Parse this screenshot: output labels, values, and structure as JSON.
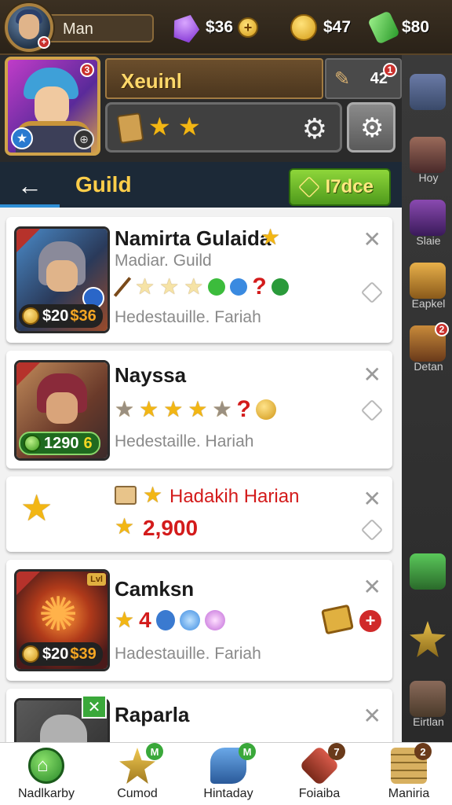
{
  "topbar": {
    "player_name": "Man",
    "avatar_badge": "+",
    "currencies": [
      {
        "icon": "purple-gem-icon",
        "value": "$36",
        "color": "#8a3cd6"
      },
      {
        "icon": "gold-coin-icon",
        "value": "$47",
        "color": "#e0a020"
      },
      {
        "icon": "green-energy-icon",
        "value": "$80",
        "color": "#3cc24a"
      }
    ]
  },
  "hero": {
    "name": "Xeuinl",
    "power": "42",
    "power_badge": "1",
    "portrait_badge": "3",
    "stars": 2,
    "colors": {
      "accent": "#d1a34a",
      "name_text": "#ffd86a"
    }
  },
  "guild_bar": {
    "title": "Guild",
    "back_glyph": "←",
    "trade_label": "I7dce"
  },
  "cards": [
    {
      "name": "Namirta Gulaida",
      "subtitle": "Madiar. Guild",
      "footer": "Hedestauille. Fariah",
      "price": "$20",
      "price_b": "$36",
      "question": "?",
      "close": "✕",
      "has_star_after_name": true
    },
    {
      "name": "Nayssa",
      "subtitle": "",
      "footer": "Hedestaille. Hariah",
      "price": "1290",
      "price_b": "6",
      "question": "?",
      "close": "✕",
      "has_star_after_name": false
    },
    {
      "name": "Hadakih Harian",
      "subtitle": "",
      "footer": "",
      "amount": "2,900",
      "close": "✕",
      "has_star_after_name": false
    },
    {
      "name": "Camksn",
      "subtitle": "",
      "footer": "Hadestauille. Fariah",
      "price": "$20",
      "price_b": "$39",
      "number": "4",
      "corner_tag": "Lvl",
      "close": "✕",
      "has_star_after_name": false
    },
    {
      "name": "Raparla",
      "subtitle": "",
      "footer": "",
      "close": "✕",
      "has_star_after_name": false
    }
  ],
  "right_strip": [
    {
      "label": "Hoy",
      "badge": "",
      "color": "#6a7aa6"
    },
    {
      "label": "Slaie",
      "badge": "",
      "color": "#6a3a8a"
    },
    {
      "label": "Eapkel",
      "badge": "",
      "color": "#c8912a"
    },
    {
      "label": "Detan",
      "badge": "2",
      "color": "#a06a2a"
    },
    {
      "label": "",
      "badge": "",
      "color": "#3a8a3a"
    },
    {
      "label": "",
      "badge": "",
      "color": "#c89a2a"
    },
    {
      "label": "Eirtlan",
      "badge": "",
      "color": "#7a5a4a"
    }
  ],
  "bottom_nav": [
    {
      "label": "Nadlkarby",
      "icon": "home-icon",
      "badge": "",
      "color": "#3fa63a"
    },
    {
      "label": "Cumod",
      "icon": "star-shield-icon",
      "badge": "M",
      "color": "#d4a230"
    },
    {
      "label": "Hintaday",
      "icon": "horn-icon",
      "badge": "M",
      "color": "#3a78c8"
    },
    {
      "label": "Foiaiba",
      "icon": "crossed-swords-icon",
      "badge": "7",
      "color": "#b03a2a"
    },
    {
      "label": "Maniria",
      "icon": "coin-stack-icon",
      "badge": "2",
      "color": "#b88a3a"
    }
  ]
}
